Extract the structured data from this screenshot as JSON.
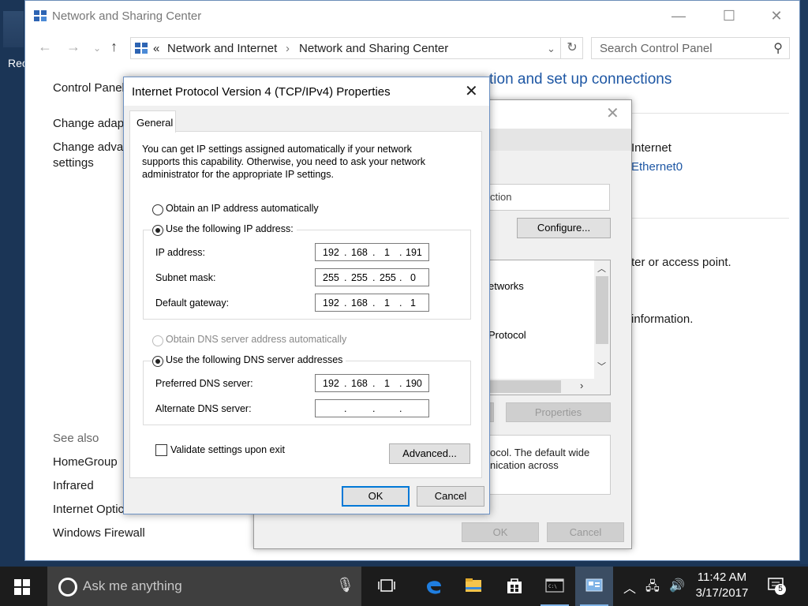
{
  "desktop": {
    "icon_label": "Rec"
  },
  "control_panel": {
    "title": "Network and Sharing Center",
    "breadcrumb": {
      "sep_start": "«",
      "item1": "Network and Internet",
      "sep": "›",
      "item2": "Network and Sharing Center"
    },
    "search_placeholder": "Search Control Panel",
    "sidebar": {
      "home": "Control Panel",
      "link1": "Change adap",
      "link2_line1": "Change advar",
      "link2_line2": "settings"
    },
    "see_also": {
      "title": "See also",
      "items": [
        "HomeGroup",
        "Infrared",
        "Internet Optic",
        "Windows Firewall"
      ]
    },
    "heading": "tion and set up connections",
    "right": {
      "internet": "Internet",
      "ethernet_link": "Ethernet0",
      "access_point": "ter or access point.",
      "information": "information."
    }
  },
  "ethernet_properties": {
    "connect_using": "ction",
    "configure": "Configure...",
    "list_items": [
      "etworks",
      "Protocol"
    ],
    "install_partial": "",
    "properties": "Properties",
    "description_line1": "ocol. The default wide",
    "description_line2": "nication across",
    "ok": "OK",
    "cancel": "Cancel"
  },
  "ipv4": {
    "title": "Internet Protocol Version 4 (TCP/IPv4) Properties",
    "tab": "General",
    "intro": [
      "You can get IP settings assigned automatically if your network",
      "supports this capability. Otherwise, you need to ask your network",
      "administrator for the appropriate IP settings."
    ],
    "obtain_ip_auto": "Obtain an IP address automatically",
    "use_following_ip": "Use the following IP address:",
    "ip_label": "IP address:",
    "ip_value": [
      "192",
      "168",
      "1",
      "191"
    ],
    "subnet_label": "Subnet mask:",
    "subnet_value": [
      "255",
      "255",
      "255",
      "0"
    ],
    "gateway_label": "Default gateway:",
    "gateway_value": [
      "192",
      "168",
      "1",
      "1"
    ],
    "obtain_dns_auto": "Obtain DNS server address automatically",
    "use_following_dns": "Use the following DNS server addresses",
    "preferred_dns_label": "Preferred DNS server:",
    "preferred_dns_value": [
      "192",
      "168",
      "1",
      "190"
    ],
    "alternate_dns_label": "Alternate DNS server:",
    "alternate_dns_value": [
      "",
      "",
      "",
      ""
    ],
    "validate": "Validate settings upon exit",
    "validate_checked": false,
    "advanced": "Advanced...",
    "ok": "OK",
    "cancel": "Cancel"
  },
  "taskbar": {
    "search_placeholder": "Ask me anything",
    "time": "11:42 AM",
    "date": "3/17/2017",
    "notification_count": "5"
  }
}
